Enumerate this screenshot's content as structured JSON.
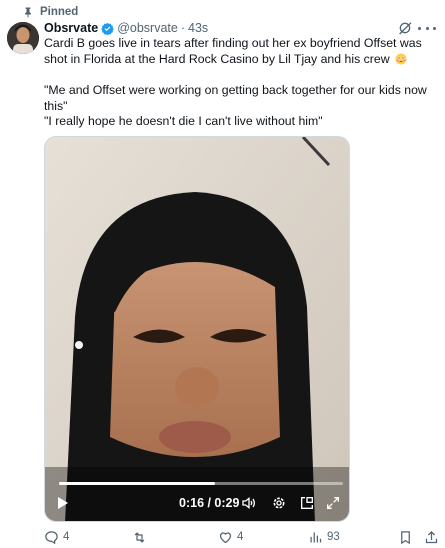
{
  "pinned": {
    "label": "Pinned",
    "icon": "pin-icon"
  },
  "author": {
    "name": "Obsrvate",
    "handle": "@obsrvate",
    "separator": "·",
    "time": "43s",
    "verified_color": "#1d9bf0",
    "avatar_icon": "avatar-image"
  },
  "tweet": {
    "line1": "Cardi B goes live in tears after finding out her ex boyfriend Offset was shot in Florida at the Hard Rock Casino by Lil Tjay and his crew",
    "emoji_icon": "flushed-face-icon",
    "quote1": "\"Me and Offset were working on getting back together for our kids now this\"",
    "quote2": "\"I really hope he doesn't die I can't live without him\""
  },
  "video": {
    "time": "0:16 / 0:29",
    "progress": 0.55,
    "controls": [
      "play-icon",
      "volume-icon",
      "settings-icon",
      "pip-icon",
      "fullscreen-icon"
    ]
  },
  "actions": {
    "replies": "4",
    "reposts": "",
    "likes": "4",
    "views": "93"
  },
  "colors": {
    "text": "#0f1419",
    "secondary": "#536471",
    "accent": "#1d9bf0"
  }
}
